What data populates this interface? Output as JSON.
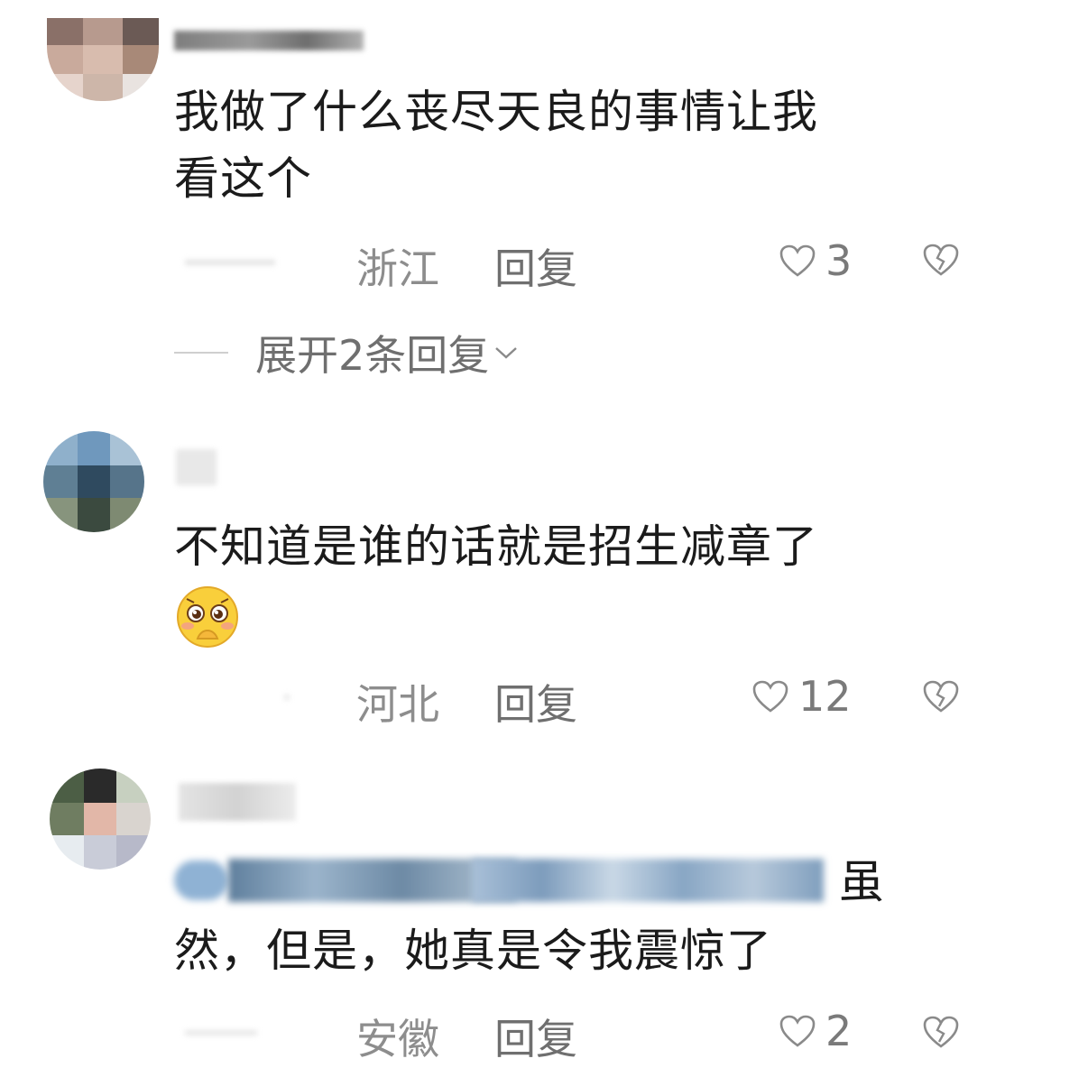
{
  "comments": [
    {
      "text_line1": "我做了什么丧尽天良的事情让我",
      "text_line2": "看这个",
      "location": "浙江",
      "reply_label": "回复",
      "likes": "3",
      "expand_label": "展开2条回复"
    },
    {
      "text_line1": "不知道是谁的话就是招生减章了",
      "location": "河北",
      "reply_label": "回复",
      "likes": "12",
      "emoji": "shy-face-emoji"
    },
    {
      "text_line1_tail": "虽",
      "text_line2": "然，但是，她真是令我震惊了",
      "location": "安徽",
      "reply_label": "回复",
      "likes": "2"
    }
  ],
  "icons": {
    "like": "heart-outline-icon",
    "dislike": "broken-heart-icon",
    "expand": "chevron-down-icon"
  },
  "colors": {
    "text": "#1b1b1b",
    "meta": "#8d8d8d",
    "emoji_yellow": "#f9cf3b"
  }
}
